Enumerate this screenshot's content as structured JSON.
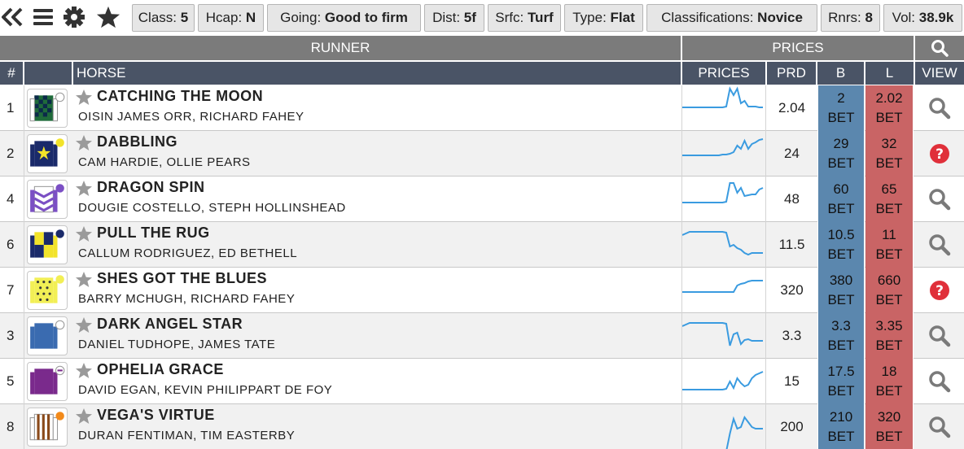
{
  "toolbar": {
    "chips": [
      {
        "key": "Class: ",
        "val": "5"
      },
      {
        "key": "Hcap: ",
        "val": "N"
      },
      {
        "key": "Going: ",
        "val": "Good to firm"
      },
      {
        "key": "Dist: ",
        "val": "5f"
      },
      {
        "key": "Srfc: ",
        "val": "Turf"
      },
      {
        "key": "Type: ",
        "val": "Flat"
      },
      {
        "key": "Classifications: ",
        "val": "Novice"
      },
      {
        "key": "Rnrs: ",
        "val": "8"
      },
      {
        "key": "Vol: ",
        "val": "38.9k"
      }
    ],
    "icons": [
      "double-chevron-left-icon",
      "hamburger-menu-icon",
      "gear-icon",
      "star-icon"
    ]
  },
  "header": {
    "runner": "RUNNER",
    "prices": "PRICES",
    "col_num": "#",
    "col_horse": "HORSE",
    "col_prices": "PRICES",
    "col_prd": "PRD",
    "col_back": "B",
    "col_lay": "L",
    "col_view": "VIEW"
  },
  "colors": {
    "back": "#5b87ae",
    "lay": "#c96465",
    "header_dark": "#4a5466",
    "header_grey": "#7b7b7b",
    "sparkline": "#3a9be0",
    "help_red": "#e0303a"
  },
  "runners": [
    {
      "num": "1",
      "horse": "CATCHING THE MOON",
      "jt": "OISIN JAMES ORR, RICHARD FAHEY",
      "prd": "2.04",
      "back": "2",
      "lay": "2.02",
      "bet": "BET",
      "view": "search-icon",
      "spark": [
        27,
        27,
        27,
        27,
        27,
        27,
        27,
        27,
        27,
        27,
        27,
        27,
        26,
        4,
        12,
        4,
        22,
        19,
        26,
        26,
        26,
        27,
        27
      ]
    },
    {
      "num": "2",
      "horse": "DABBLING",
      "jt": "CAM HARDIE, OLLIE PEARS",
      "prd": "24",
      "back": "29",
      "lay": "32",
      "bet": "BET",
      "view": "help-icon",
      "spark": [
        30,
        30,
        30,
        30,
        30,
        30,
        30,
        30,
        30,
        30,
        30,
        29,
        29,
        28,
        26,
        18,
        22,
        12,
        22,
        16,
        14,
        11,
        10
      ]
    },
    {
      "num": "4",
      "horse": "DRAGON SPIN",
      "jt": "DOUGIE COSTELLO, STEPH HOLLINSHEAD",
      "prd": "48",
      "back": "60",
      "lay": "65",
      "bet": "BET",
      "view": "search-icon",
      "spark": [
        32,
        32,
        32,
        32,
        32,
        32,
        32,
        32,
        32,
        32,
        32,
        32,
        31,
        8,
        8,
        20,
        14,
        24,
        23,
        22,
        22,
        16,
        14
      ]
    },
    {
      "num": "6",
      "horse": "PULL THE RUG",
      "jt": "CALLUM RODRIGUEZ, ED BETHELL",
      "prd": "11.5",
      "back": "10.5",
      "lay": "11",
      "bet": "BET",
      "view": "search-icon",
      "spark": [
        16,
        14,
        12,
        12,
        12,
        12,
        12,
        12,
        12,
        12,
        12,
        12,
        13,
        30,
        28,
        32,
        34,
        38,
        40,
        38,
        38,
        38,
        38
      ]
    },
    {
      "num": "7",
      "horse": "SHES GOT THE BLUES",
      "jt": "BARRY MCHUGH, RICHARD FAHEY",
      "prd": "320",
      "back": "380",
      "lay": "660",
      "bet": "BET",
      "view": "help-icon",
      "spark": [
        30,
        30,
        30,
        30,
        30,
        30,
        30,
        30,
        30,
        30,
        30,
        30,
        30,
        30,
        30,
        22,
        20,
        19,
        17,
        16,
        16,
        16,
        16
      ]
    },
    {
      "num": "3",
      "horse": "DARK ANGEL STAR",
      "jt": "DANIEL TUDHOPE, JAMES TATE",
      "prd": "3.3",
      "back": "3.3",
      "lay": "3.35",
      "bet": "BET",
      "view": "search-icon",
      "spark": [
        16,
        14,
        12,
        12,
        12,
        12,
        12,
        12,
        12,
        12,
        12,
        12,
        13,
        40,
        26,
        24,
        38,
        33,
        32,
        34,
        34,
        34,
        34
      ]
    },
    {
      "num": "5",
      "horse": "OPHELIA GRACE",
      "jt": "DAVID EGAN, KEVIN PHILIPPART DE FOY",
      "prd": "15",
      "back": "17.5",
      "lay": "18",
      "bet": "BET",
      "view": "search-icon",
      "spark": [
        38,
        38,
        38,
        38,
        38,
        38,
        38,
        38,
        38,
        38,
        38,
        38,
        37,
        28,
        36,
        24,
        30,
        34,
        32,
        24,
        20,
        18,
        16
      ]
    },
    {
      "num": "8",
      "horse": "VEGA'S VIRTUE",
      "jt": "DURAN FENTIMAN, TIM EASTERBY",
      "prd": "200",
      "back": "210",
      "lay": "320",
      "bet": "BET",
      "view": "search-icon",
      "spark": [
        60,
        60,
        60,
        60,
        60,
        60,
        60,
        60,
        60,
        60,
        60,
        60,
        58,
        36,
        18,
        30,
        28,
        16,
        22,
        28,
        30,
        30,
        30
      ]
    }
  ]
}
